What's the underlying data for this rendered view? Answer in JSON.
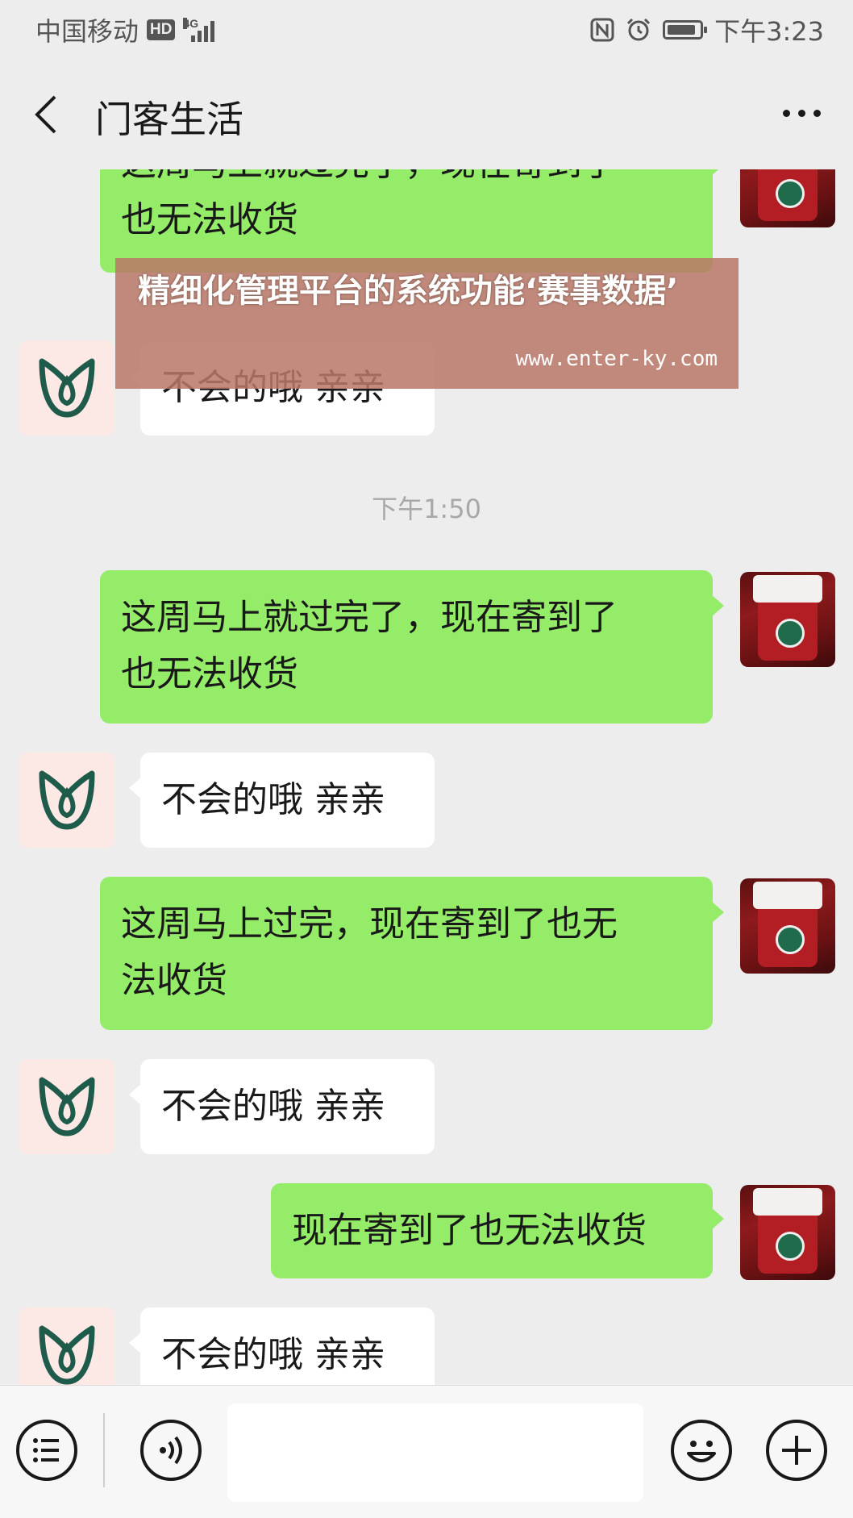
{
  "status_bar": {
    "carrier": "中国移动",
    "hd": "HD",
    "network": "4G",
    "time": "下午3:23"
  },
  "header": {
    "title": "门客生活"
  },
  "overlay": {
    "title": "精细化管理平台的系统功能‘赛事数据’",
    "url": "www.enter-ky.com"
  },
  "messages": [
    {
      "side": "out",
      "lines": [
        "这周马上就过完了，现在寄到了",
        "也无法收货"
      ]
    },
    {
      "side": "in",
      "lines": [
        "不会的哦 亲亲"
      ]
    },
    {
      "side": "time",
      "text": "下午1:50"
    },
    {
      "side": "out",
      "lines": [
        "这周马上就过完了，现在寄到了",
        "也无法收货"
      ]
    },
    {
      "side": "in",
      "lines": [
        "不会的哦 亲亲"
      ]
    },
    {
      "side": "out",
      "lines": [
        "这周马上过完，现在寄到了也无",
        "法收货"
      ]
    },
    {
      "side": "in",
      "lines": [
        "不会的哦 亲亲"
      ]
    },
    {
      "side": "out",
      "lines": [
        "现在寄到了也无法收货"
      ]
    },
    {
      "side": "in",
      "lines": [
        "不会的哦 亲亲"
      ]
    }
  ],
  "input_bar": {
    "menu_icon": "menu-list-icon",
    "voice_icon": "voice-icon",
    "emoji_icon": "emoji-icon",
    "plus_icon": "plus-icon",
    "input_value": ""
  },
  "colors": {
    "background": "#ededed",
    "outgoing_bubble": "#95ec69",
    "incoming_bubble": "#ffffff",
    "shop_avatar_bg": "#fce8e4",
    "shop_logo": "#1f5b4a"
  }
}
